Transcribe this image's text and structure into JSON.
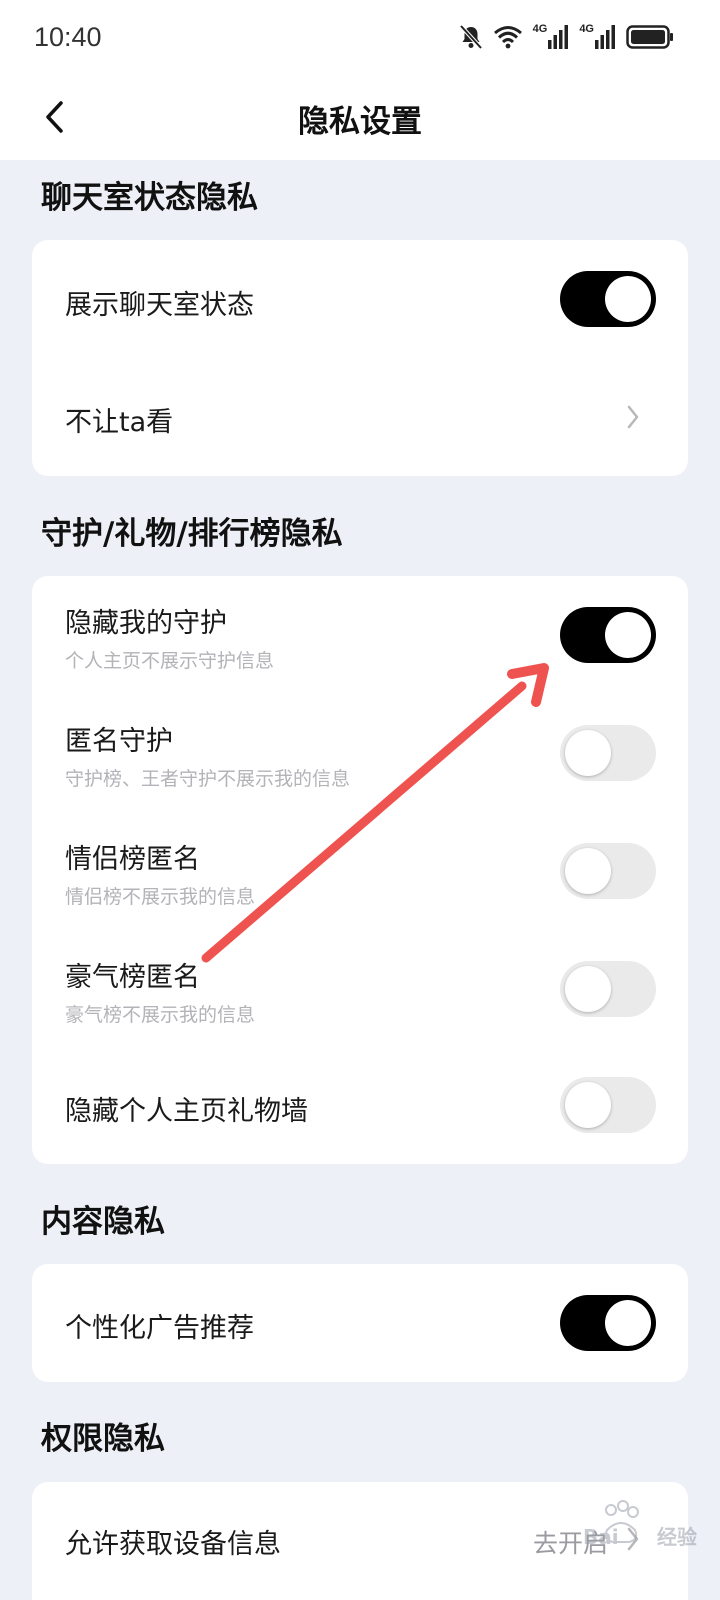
{
  "status_bar": {
    "time": "10:40",
    "network1": "4G",
    "network2": "4G",
    "icons": [
      "bell-off-icon",
      "wifi-icon",
      "signal-icon",
      "signal-icon",
      "battery-icon"
    ]
  },
  "header": {
    "title": "隐私设置",
    "back_icon": "chevron-left-icon"
  },
  "sections": {
    "chatroom": {
      "title": "聊天室状态隐私",
      "show_status": {
        "label": "展示聊天室状态",
        "enabled": true
      },
      "hide_from": {
        "label": "不让ta看"
      }
    },
    "guard": {
      "title": "守护/礼物/排行榜隐私",
      "hide_guard": {
        "label": "隐藏我的守护",
        "sub": "个人主页不展示守护信息",
        "enabled": true
      },
      "anon_guard": {
        "label": "匿名守护",
        "sub": "守护榜、王者守护不展示我的信息",
        "enabled": false
      },
      "couple_anon": {
        "label": "情侣榜匿名",
        "sub": "情侣榜不展示我的信息",
        "enabled": false
      },
      "rich_anon": {
        "label": "豪气榜匿名",
        "sub": "豪气榜不展示我的信息",
        "enabled": false
      },
      "hide_giftwall": {
        "label": "隐藏个人主页礼物墙",
        "enabled": false
      }
    },
    "content": {
      "title": "内容隐私",
      "personalized_ads": {
        "label": "个性化广告推荐",
        "enabled": true
      }
    },
    "permission": {
      "title": "权限隐私",
      "device_info": {
        "label": "允许获取设备信息",
        "value": "去开启"
      }
    }
  },
  "colors": {
    "background": "#eef0f7",
    "toggle_on": "#000000",
    "toggle_off": "#eaeaea",
    "annotation_arrow": "#ef5350"
  },
  "watermark": "Baidu 经验"
}
